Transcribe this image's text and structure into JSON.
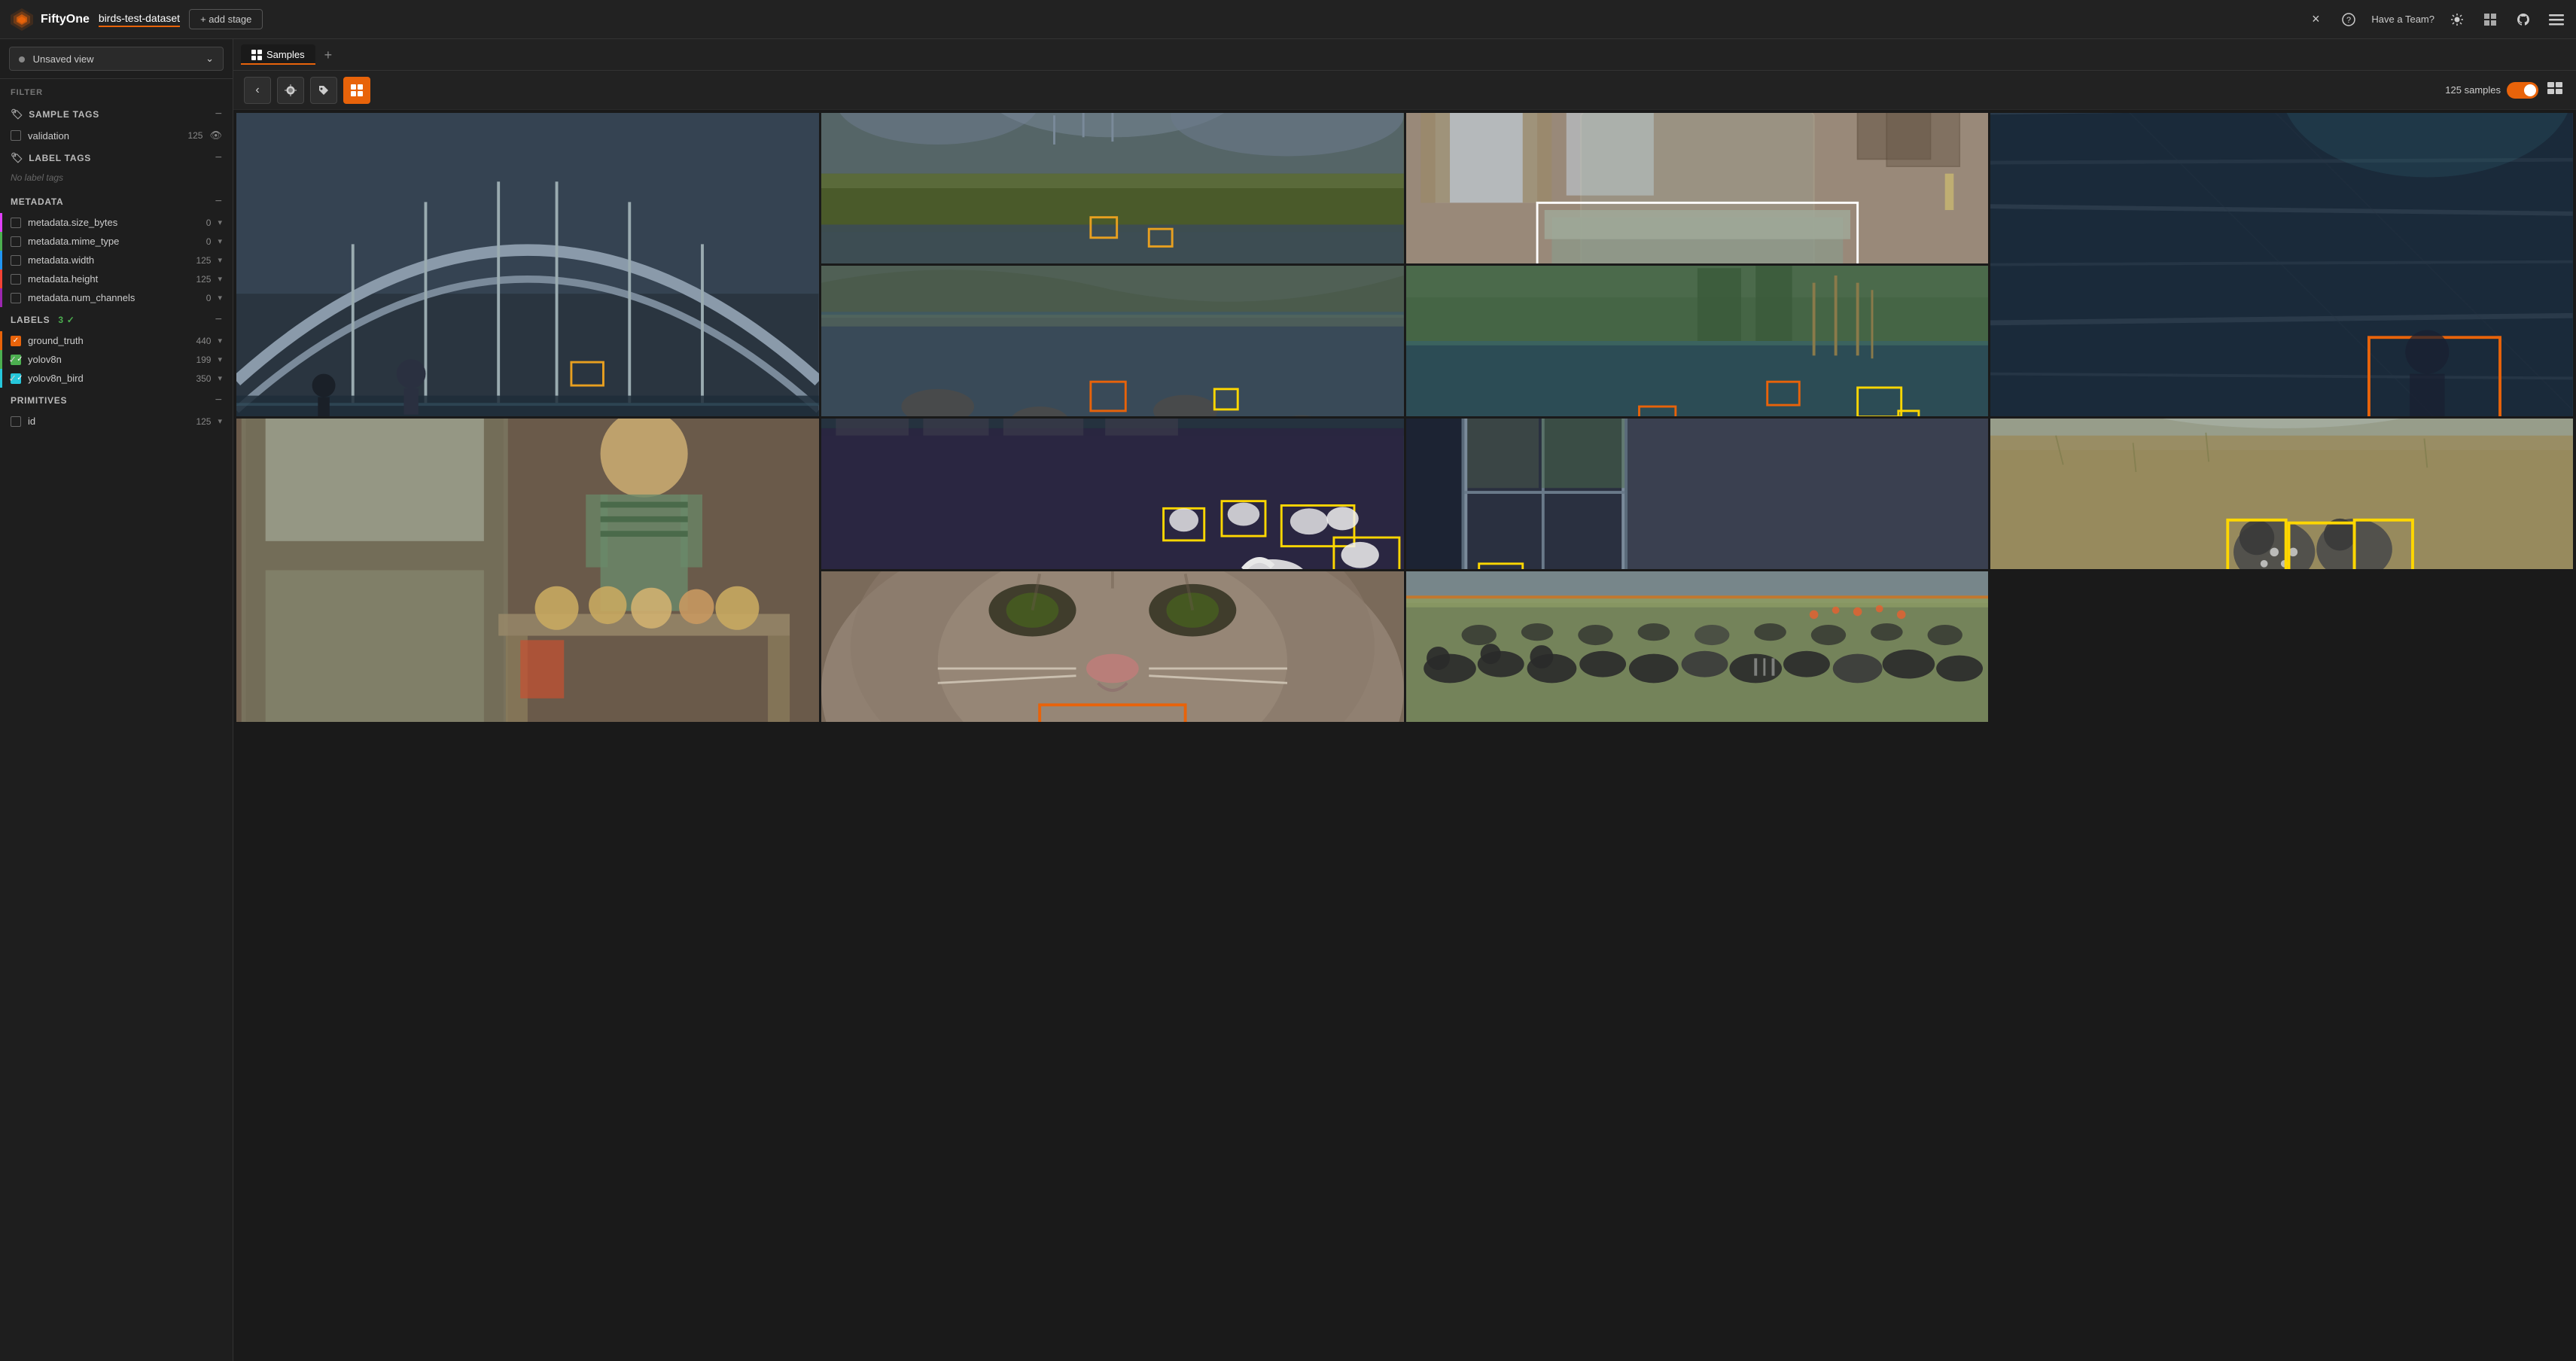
{
  "header": {
    "app_name": "FiftyOne",
    "dataset_name": "birds-test-dataset",
    "add_stage_label": "+ add stage",
    "have_team_label": "Have a Team?",
    "close_label": "×",
    "help_label": "?"
  },
  "sidebar": {
    "unsaved_view_label": "Unsaved view",
    "filter_label": "FILTER",
    "sample_tags_label": "SAMPLE TAGS",
    "label_tags_label": "LABEL TAGS",
    "no_label_tags": "No label tags",
    "metadata_label": "METADATA",
    "labels_label": "LABELS",
    "labels_count": "3",
    "primitives_label": "PRIMITIVES",
    "sample_tags": [
      {
        "name": "validation",
        "count": "125",
        "checked": false
      }
    ],
    "metadata_items": [
      {
        "name": "metadata.size_bytes",
        "count": "0",
        "accent": "pink"
      },
      {
        "name": "metadata.mime_type",
        "count": "0",
        "accent": "green"
      },
      {
        "name": "metadata.width",
        "count": "125",
        "accent": "blue"
      },
      {
        "name": "metadata.height",
        "count": "125",
        "accent": "red"
      },
      {
        "name": "metadata.num_channels",
        "count": "0",
        "accent": "purple"
      }
    ],
    "label_items": [
      {
        "name": "ground_truth",
        "count": "440",
        "checked": true,
        "accent": "orange"
      },
      {
        "name": "yolov8n",
        "count": "199",
        "checked": true,
        "accent": "green"
      },
      {
        "name": "yolov8n_bird",
        "count": "350",
        "checked": true,
        "accent": "teal"
      }
    ],
    "primitive_items": [
      {
        "name": "id",
        "count": "125",
        "checked": false
      }
    ]
  },
  "toolbar": {
    "samples_tab_label": "Samples",
    "sample_count_label": "125 samples"
  },
  "images": [
    {
      "id": "img1",
      "bg": "#4a5a6a",
      "description": "waterfront arch bridge scene",
      "tall": true
    },
    {
      "id": "img2",
      "bg": "#5a6a4a",
      "description": "marsh harbor boats",
      "tall": false
    },
    {
      "id": "img3",
      "bg": "#7a6a5a",
      "description": "bedroom with mosquito net",
      "tall": false
    },
    {
      "id": "img4",
      "bg": "#3a4a5a",
      "description": "blue wood texture close-up",
      "tall": true
    },
    {
      "id": "img5",
      "bg": "#6a5a4a",
      "description": "child with cookies indoors",
      "tall": true
    },
    {
      "id": "img6",
      "bg": "#4a6a5a",
      "description": "river with rocks birds",
      "tall": false
    },
    {
      "id": "img7",
      "bg": "#5a6a4a",
      "description": "pond with reeds birds",
      "tall": false
    },
    {
      "id": "img8",
      "bg": "#3a4a5a",
      "description": "harbor with swans",
      "tall": false
    },
    {
      "id": "img9",
      "bg": "#5a4a3a",
      "description": "window frame exterior",
      "tall": false
    },
    {
      "id": "img10",
      "bg": "#6a7a5a",
      "description": "guinea fowl in field",
      "tall": false
    },
    {
      "id": "img11",
      "bg": "#8a7a6a",
      "description": "cat close-up face",
      "tall": false
    },
    {
      "id": "img12",
      "bg": "#5a6a5a",
      "description": "zebra wildebeest migration",
      "tall": false
    }
  ]
}
